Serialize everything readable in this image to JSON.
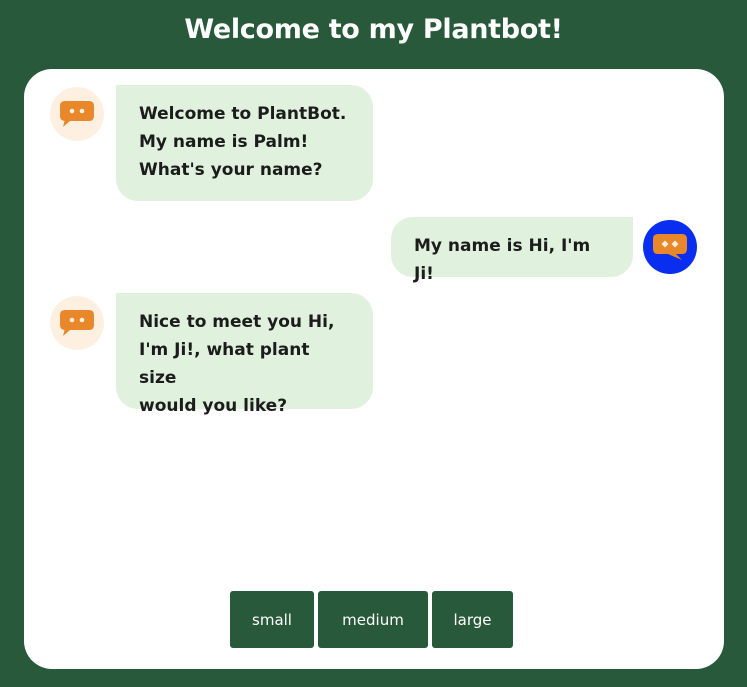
{
  "header": {
    "title": "Welcome to my Plantbot!"
  },
  "colors": {
    "background": "#27593a",
    "panel": "#ffffff",
    "bubble": "#e0f2de",
    "bot_avatar_bg": "#fdf0e1",
    "user_avatar_bg": "#0a2ef0",
    "icon_orange": "#e8882b",
    "button_bg": "#27593a"
  },
  "messages": [
    {
      "sender": "bot",
      "icon": "chat-bot-icon",
      "lines": [
        "Welcome to PlantBot.",
        "My name is Palm!",
        "What's your name?"
      ]
    },
    {
      "sender": "user",
      "icon": "chat-user-icon",
      "lines": [
        "My name is Hi, I'm Ji!"
      ]
    },
    {
      "sender": "bot",
      "icon": "chat-bot-icon",
      "lines": [
        "Nice to meet you Hi,",
        "I'm Ji!, what plant size",
        "would you like?"
      ]
    }
  ],
  "options": [
    {
      "label": "small"
    },
    {
      "label": "medium"
    },
    {
      "label": "large"
    }
  ]
}
